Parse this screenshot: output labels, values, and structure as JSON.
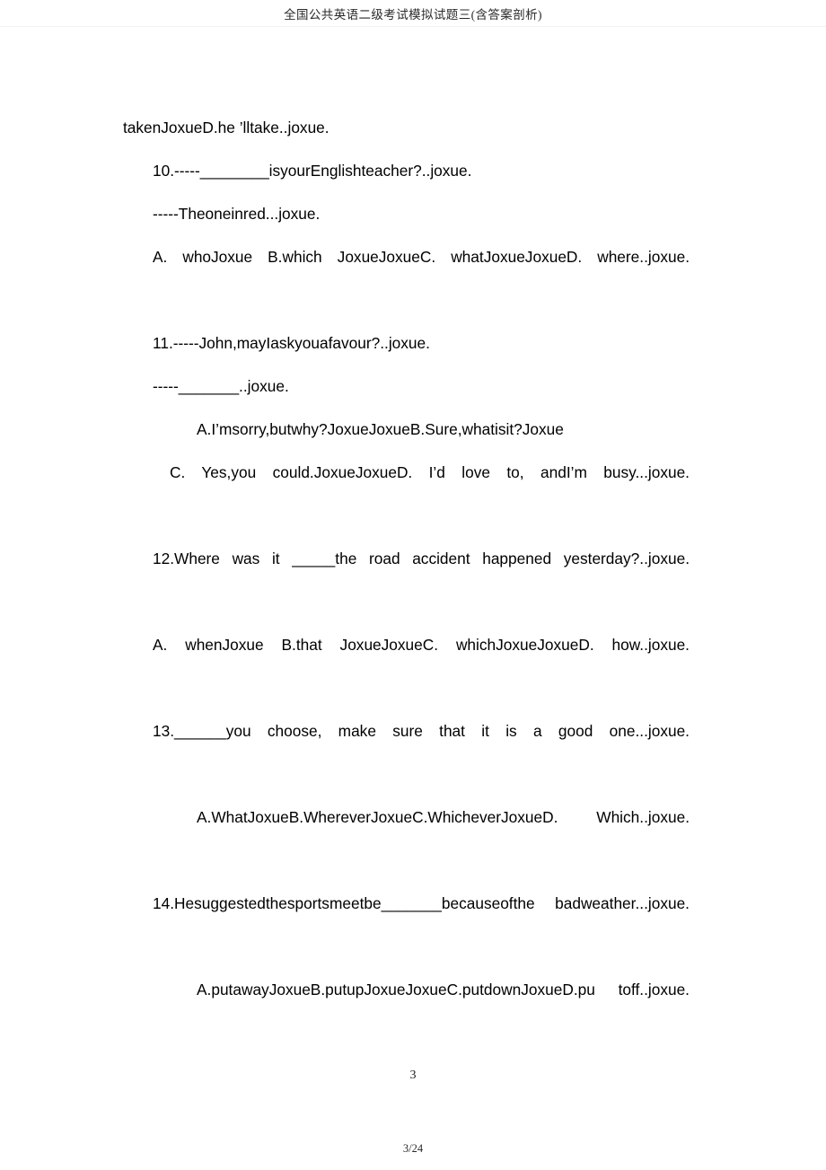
{
  "header": {
    "title": "全国公共英语二级考试模拟试题三(含答案剖析)"
  },
  "body": {
    "paragraphs": [
      {
        "id": "continuation-line",
        "text": "takenJoxueD.he    ’lltake..joxue.",
        "indent": "none",
        "justify": false
      },
      {
        "id": "question-10-stem",
        "text": "10.-----________isyourEnglishteacher?..joxue.",
        "indent": "1",
        "justify": false
      },
      {
        "id": "question-10-answer-line",
        "text": "-----Theoneinred...joxue.",
        "indent": "1",
        "justify": false
      },
      {
        "id": "question-10-options",
        "text": "A.  whoJoxue   B.which      JoxueJoxueC.   whatJoxueJoxueD. where..joxue.",
        "indent": "1",
        "justify": true
      },
      {
        "id": "question-11-stem",
        "text": "11.-----John,mayIaskyouafavour?..joxue.",
        "indent": "1",
        "justify": false
      },
      {
        "id": "question-11-answer-line",
        "text": "-----_______..joxue.",
        "indent": "1",
        "justify": false
      },
      {
        "id": "question-11-options-ab",
        "text": "A.I’msorry,butwhy?JoxueJoxueB.Sure,whatisit?Joxue",
        "indent": "3",
        "justify": false
      },
      {
        "id": "question-11-options-cd",
        "text": "C.  Yes,you    could.JoxueJoxueD.   I’d  love    to,  andI’m busy...joxue.",
        "indent": "2",
        "justify": true
      },
      {
        "id": "question-12-stem",
        "text": "12.Where     was    it    _____the   road    accident    happened yesterday?..joxue.",
        "indent": "1",
        "justify": true
      },
      {
        "id": "question-12-options",
        "text": "A.   whenJoxue    B.that      JoxueJoxueC.   whichJoxueJoxueD. how..joxue.",
        "indent": "1",
        "justify": true
      },
      {
        "id": "question-13-stem",
        "text": "13.______you   choose,    make    sure    that    it   is   a   good one...joxue.",
        "indent": "1",
        "justify": true
      },
      {
        "id": "question-13-options",
        "text": "A.WhatJoxueB.WhereverJoxueC.WhicheverJoxueD. Which..joxue.",
        "indent": "3",
        "justify": true
      },
      {
        "id": "question-14-stem",
        "text": "14.Hesuggestedthesportsmeetbe_______becauseofthe badweather...joxue.",
        "indent": "1",
        "justify": true
      },
      {
        "id": "question-14-options",
        "text": "A.putawayJoxueB.putupJoxueJoxueC.putdownJoxueD.pu toff..joxue.",
        "indent": "3",
        "justify": true
      }
    ]
  },
  "footer": {
    "page_number": "3",
    "page_fraction": "3/24"
  }
}
